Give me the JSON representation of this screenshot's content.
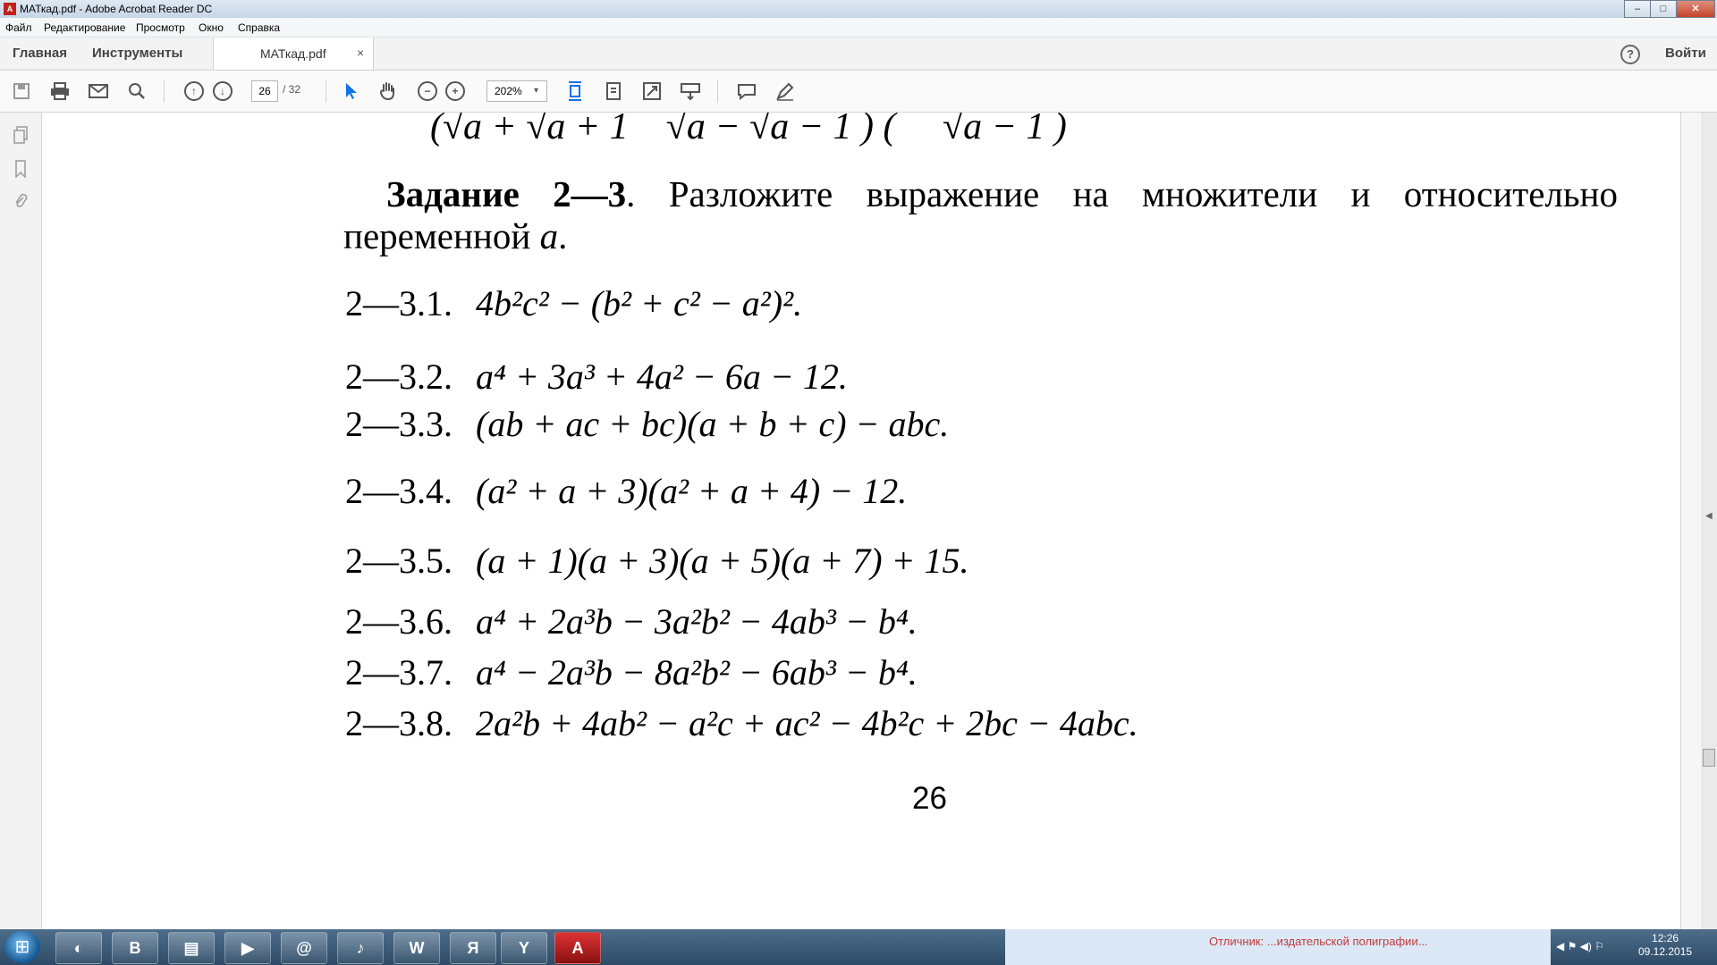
{
  "window": {
    "title": "МАТкад.pdf - Adobe Acrobat Reader DC",
    "controls": {
      "minimize": "–",
      "maximize": "□",
      "close": "✕"
    }
  },
  "menu": [
    "Файл",
    "Редактирование",
    "Просмотр",
    "Окно",
    "Справка"
  ],
  "tabs": {
    "home": "Главная",
    "tools": "Инструменты",
    "document": "МАТкад.pdf",
    "close": "×"
  },
  "header": {
    "help": "?",
    "sign_in": "Войти"
  },
  "toolbar": {
    "page_current": "26",
    "page_total": "/ 32",
    "zoom": "202%",
    "zoom_caret": "▾",
    "icons": [
      "save-icon",
      "print-icon",
      "email-icon",
      "search-icon",
      "page-up-icon",
      "page-down-icon",
      "select-cursor-icon",
      "hand-tool-icon",
      "zoom-out-icon",
      "zoom-in-icon",
      "fit-page-icon",
      "scroll-mode-icon",
      "full-screen-icon",
      "read-mode-icon",
      "comment-icon",
      "sign-icon"
    ]
  },
  "left_rail": [
    "page-thumbnails-icon",
    "bookmarks-icon",
    "attachments-icon"
  ],
  "document": {
    "top_fragment": "(√a + √a + 1    √a − √a − 1 ) (     √a − 1 )",
    "heading_bold": "Задание 2—3",
    "heading_text": ". Разложите выражение на множители и относительно переменной ",
    "heading_var": "a",
    "heading_end": ".",
    "exercises": [
      {
        "label": "2—3.1.",
        "expr": "4b²c² − (b² + c² − a²)²."
      },
      {
        "label": "2—3.2.",
        "expr": "a⁴ + 3a³ + 4a² − 6a − 12."
      },
      {
        "label": "2—3.3.",
        "expr": "(ab + ac + bc)(a + b + c) − abc."
      },
      {
        "label": "2—3.4.",
        "expr": "(a² + a + 3)(a² + a + 4) − 12."
      },
      {
        "label": "2—3.5.",
        "expr": "(a + 1)(a + 3)(a + 5)(a + 7) + 15."
      },
      {
        "label": "2—3.6.",
        "expr": "a⁴ + 2a³b − 3a²b² − 4ab³ − b⁴."
      },
      {
        "label": "2—3.7.",
        "expr": "a⁴ − 2a³b − 8a²b² − 6ab³ − b⁴."
      },
      {
        "label": "2—3.8.",
        "expr": "2a²b + 4ab² − a²c + ac² − 4b²c + 2bc − 4abc."
      }
    ],
    "page_number": "26"
  },
  "taskbar": {
    "start": "⊞",
    "apps": [
      {
        "name": "media-app",
        "glyph": "◐"
      },
      {
        "name": "vk-app",
        "glyph": "B"
      },
      {
        "name": "explorer-app",
        "glyph": "▤"
      },
      {
        "name": "player-app",
        "glyph": "▶"
      },
      {
        "name": "mail-agent-app",
        "glyph": "@"
      },
      {
        "name": "music-app",
        "glyph": "♪"
      },
      {
        "name": "word-app",
        "glyph": "W"
      },
      {
        "name": "yandex-app",
        "glyph": "Я"
      },
      {
        "name": "yandex-browser-app",
        "glyph": "Y"
      },
      {
        "name": "acrobat-app",
        "glyph": "A"
      }
    ],
    "notice": "Отличник: ...издательской полиграфии...",
    "time": "12:26",
    "date": "09.12.2015",
    "tray_icons": "◀ ⚑ ◀) ⚐"
  }
}
